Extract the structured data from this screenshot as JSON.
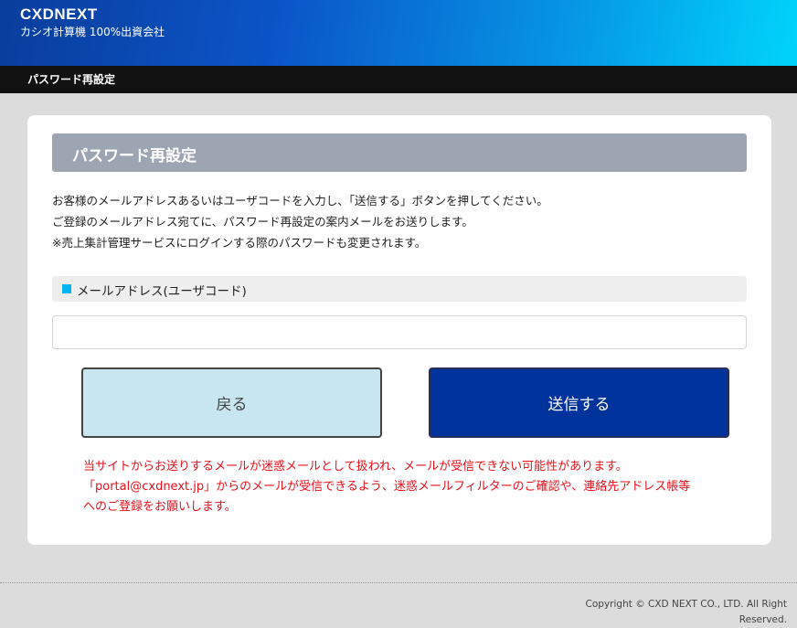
{
  "header": {
    "logo_text": "CXDNEXT",
    "subtitle": "カシオ計算機 100%出資会社"
  },
  "nav": {
    "title": "パスワード再設定"
  },
  "main": {
    "section_title": "パスワード再設定",
    "instructions": [
      "お客様のメールアドレスあるいはユーザコードを入力し、「送信する」ボタンを押してください。",
      "ご登録のメールアドレス宛てに、パスワード再設定の案内メールをお送りします。",
      "※売上集計管理サービスにログインする際のパスワードも変更されます。"
    ],
    "field_label": "メールアドレス(ユーザコード)",
    "email_value": "",
    "email_placeholder": "",
    "back_label": "戻る",
    "send_label": "送信する",
    "warning": [
      "当サイトからお送りするメールが迷惑メールとして扱われ、メールが受信できない可能性があります。",
      "「portal@cxdnext.jp」からのメールが受信できるよう、迷惑メールフィルターのご確認や、連絡先アドレス帳等",
      "へのご登録をお願いします。"
    ]
  },
  "footer": {
    "copyright_line1": "Copyright © CXD NEXT CO., LTD. All Right",
    "copyright_line2": "Reserved."
  },
  "colors": {
    "accent": "#00339b",
    "marker": "#00b4f0",
    "warning": "#e8101a",
    "back_button": "#c8e6f0",
    "section_header": "#9ea5b2"
  }
}
